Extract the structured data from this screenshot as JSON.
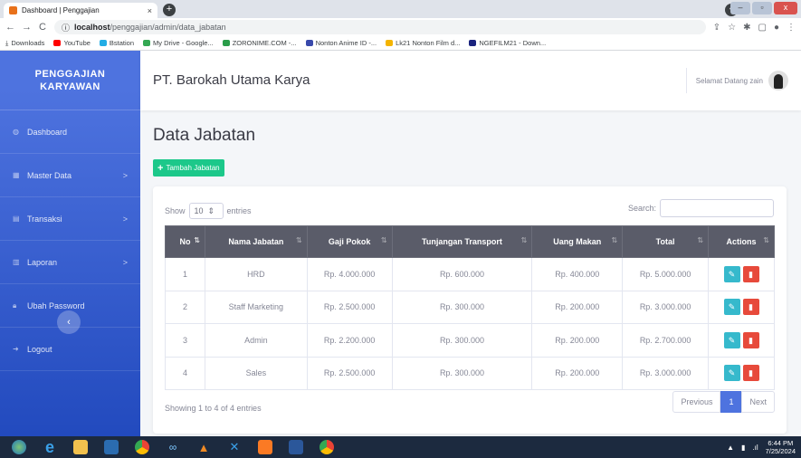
{
  "browser": {
    "tab_title": "Dashboard | Penggajian",
    "tab_close": "×",
    "new_tab": "+",
    "url_host": "localhost",
    "url_path": "/penggajian/admin/data_jabatan",
    "bookmarks": [
      "Downloads",
      "YouTube",
      "Bstation",
      "My Drive - Google...",
      "ZORONIME.COM -...",
      "Nonton Anime ID -...",
      "Lk21 Nonton Film d...",
      "NGEFILM21 - Down..."
    ]
  },
  "sidebar": {
    "brand_line1": "PENGGAJIAN",
    "brand_line2": "KARYAWAN",
    "items": [
      {
        "label": "Dashboard",
        "chevron": ""
      },
      {
        "label": "Master Data",
        "chevron": ">"
      },
      {
        "label": "Transaksi",
        "chevron": ">"
      },
      {
        "label": "Laporan",
        "chevron": ">"
      },
      {
        "label": "Ubah Password",
        "chevron": ""
      },
      {
        "label": "Logout",
        "chevron": ""
      }
    ],
    "collapse": "‹"
  },
  "topbar": {
    "company": "PT. Barokah Utama Karya",
    "greeting": "Selamat Datang zain"
  },
  "page": {
    "title": "Data Jabatan",
    "add_button": "Tambah Jabatan"
  },
  "table": {
    "show_label": "Show",
    "entries_value": "10",
    "entries_label": "entries",
    "search_label": "Search:",
    "headers": [
      "No",
      "Nama Jabatan",
      "Gaji Pokok",
      "Tunjangan Transport",
      "Uang Makan",
      "Total",
      "Actions"
    ],
    "rows": [
      [
        "1",
        "HRD",
        "Rp. 4.000.000",
        "Rp. 600.000",
        "Rp. 400.000",
        "Rp. 5.000.000"
      ],
      [
        "2",
        "Staff Marketing",
        "Rp. 2.500.000",
        "Rp. 300.000",
        "Rp. 200.000",
        "Rp. 3.000.000"
      ],
      [
        "3",
        "Admin",
        "Rp. 2.200.000",
        "Rp. 300.000",
        "Rp. 200.000",
        "Rp. 2.700.000"
      ],
      [
        "4",
        "Sales",
        "Rp. 2.500.000",
        "Rp. 300.000",
        "Rp. 200.000",
        "Rp. 3.000.000"
      ]
    ],
    "info": "Showing 1 to 4 of 4 entries",
    "prev": "Previous",
    "page": "1",
    "next": "Next"
  },
  "taskbar": {
    "time": "6:44 PM",
    "date": "7/25/2024"
  },
  "colors": {
    "sidebar_top": "#4e73df",
    "sidebar_bottom": "#224abe",
    "add_button": "#1cc88a",
    "edit_button": "#36b9cc",
    "delete_button": "#e74a3b",
    "table_header": "#5a5c69"
  }
}
